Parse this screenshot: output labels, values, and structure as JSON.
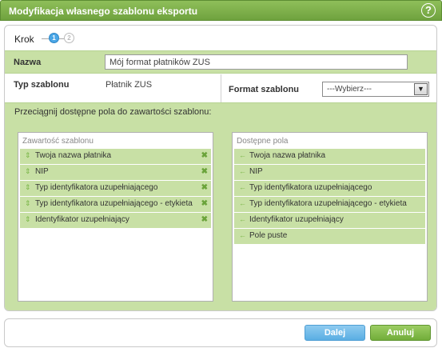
{
  "window": {
    "title": "Modyfikacja własnego szablonu eksportu",
    "help_label": "?"
  },
  "steps": {
    "label": "Krok",
    "items": [
      "1",
      "2"
    ],
    "active": 1
  },
  "name_row": {
    "label": "Nazwa",
    "value": "Mój format płatników ZUS"
  },
  "type_row": {
    "label": "Typ szablonu",
    "value": "Płatnik ZUS"
  },
  "format_row": {
    "label": "Format szablonu",
    "selected": "---Wybierz---"
  },
  "drag_hint": "Przeciągnij dostępne pola do zawartości szablonu:",
  "template_content": {
    "header": "Zawartość szablonu",
    "items": [
      {
        "label": "Twoja nazwa płatnika"
      },
      {
        "label": "NIP"
      },
      {
        "label": "Typ identyfikatora uzupełniającego"
      },
      {
        "label": "Typ identyfikatora uzupełniającego - etykieta"
      },
      {
        "label": "Identyfikator uzupełniający"
      }
    ]
  },
  "available_fields": {
    "header": "Dostępne pola",
    "items": [
      {
        "label": "Twoja nazwa płatnika"
      },
      {
        "label": "NIP"
      },
      {
        "label": "Typ identyfikatora uzupełniającego"
      },
      {
        "label": "Typ identyfikatora uzupełniającego - etykieta"
      },
      {
        "label": "Identyfikator uzupełniający"
      },
      {
        "label": "Pole puste"
      }
    ]
  },
  "buttons": {
    "next": "Dalej",
    "cancel": "Anuluj"
  },
  "colors": {
    "titlebar": "#7cb048",
    "accent_green": "#c8e0a5",
    "button_blue": "#5aaee3",
    "button_green": "#72ad3a"
  },
  "icons": {
    "drag_handle": "updown-arrow-icon",
    "remove": "close-x-icon",
    "add": "left-arrow-icon",
    "help": "help-icon",
    "dropdown": "chevron-down-icon"
  }
}
